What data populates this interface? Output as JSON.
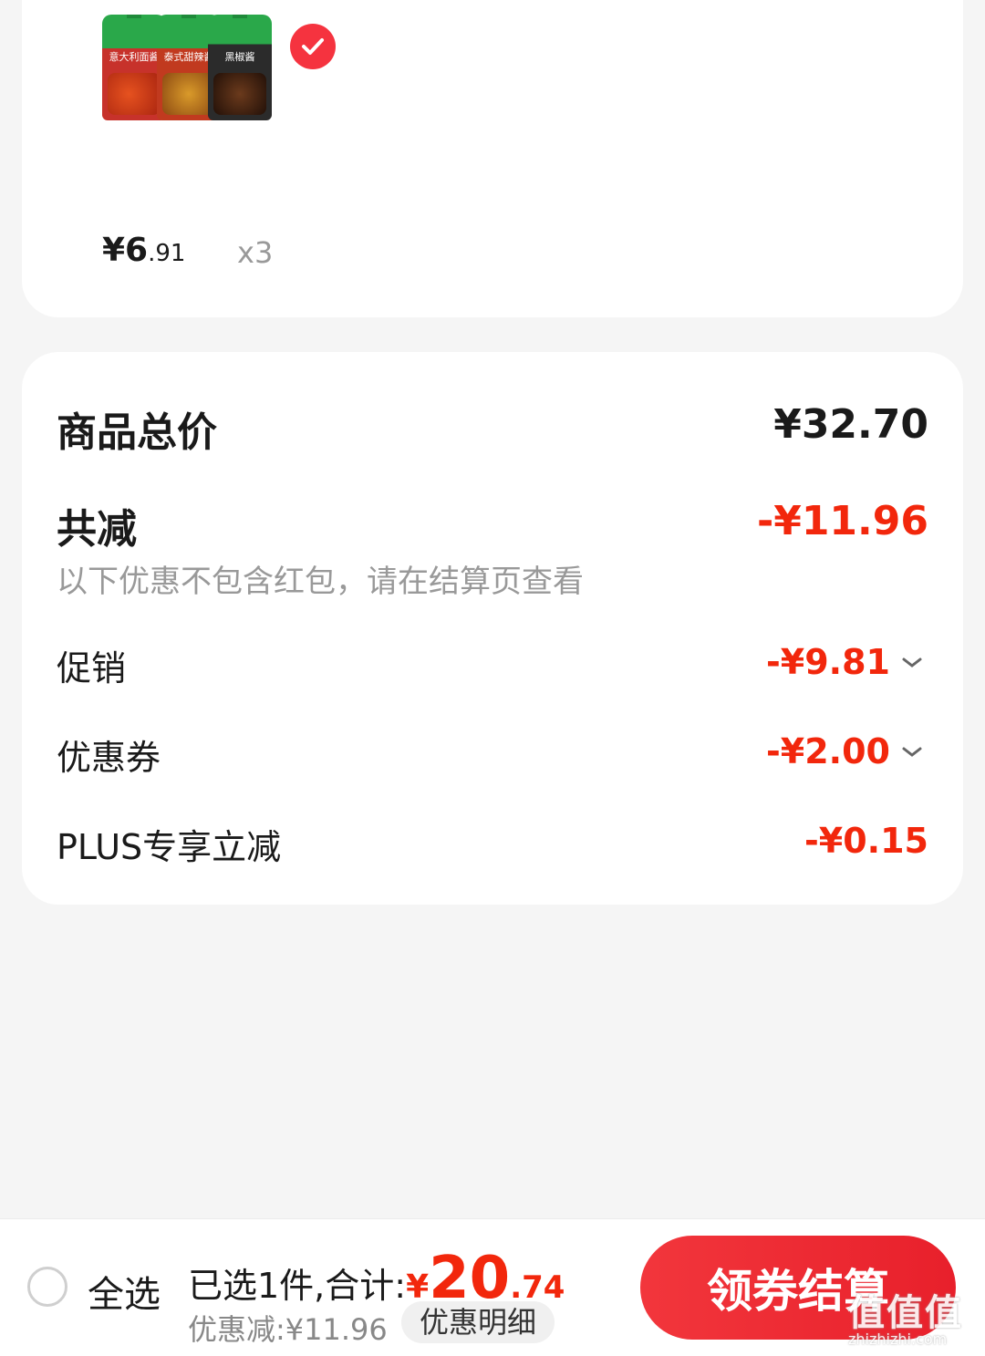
{
  "product": {
    "image_icon": "sauce-pouches-image",
    "labels": [
      "意大利面酱",
      "泰式甜辣酱",
      "黑椒酱"
    ],
    "price_int": "¥6",
    "price_dec": ".91",
    "quantity": "x3",
    "selected": true
  },
  "summary": {
    "total_label": "商品总价",
    "total_value": "¥32.70",
    "reduce_label": "共减",
    "reduce_value": "-¥11.96",
    "note": "以下优惠不包含红包，请在结算页查看",
    "promo_label": "促销",
    "promo_value": "-¥9.81",
    "coupon_label": "优惠券",
    "coupon_value": "-¥2.00",
    "plus_label": "PLUS专享立减",
    "plus_value": "-¥0.15"
  },
  "bottom": {
    "select_all": "全选",
    "selected_text": "已选1件,合计:",
    "currency": "¥",
    "total_int": "20",
    "total_dec": ".74",
    "discount_text": "优惠减:¥11.96",
    "detail_button": "优惠明细",
    "checkout_button": "领券结算"
  },
  "watermark": {
    "text": "值值值",
    "url": "zhizhizhi.com"
  },
  "colors": {
    "accent_red": "#f2270c",
    "button_red": "#e8202b",
    "background": "#f5f5f5"
  }
}
